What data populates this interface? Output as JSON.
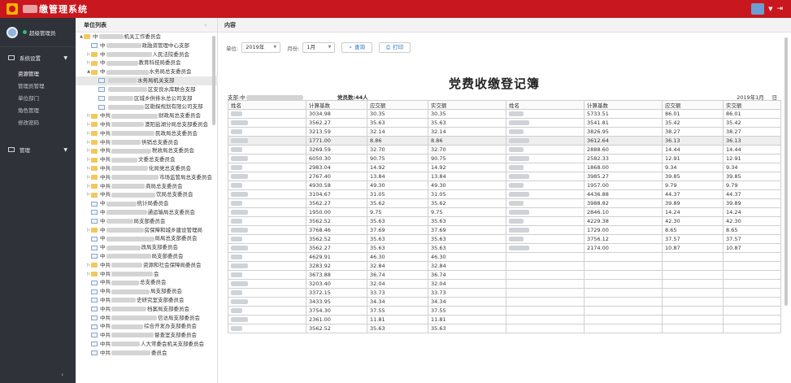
{
  "app": {
    "title": "缴管理系统"
  },
  "nav": {
    "user": "超级管理员",
    "groups": [
      {
        "label": "系统设置",
        "items": [
          "资源管理",
          "管理员管理",
          "单位部门",
          "角色管理",
          "修改密码"
        ]
      },
      {
        "label": "管理",
        "items": []
      }
    ]
  },
  "tree": {
    "title": "单位列表",
    "collapse_icon": "«",
    "rows": [
      {
        "lvl": 0,
        "exp": "▲",
        "icon": "folder",
        "pre": "中",
        "suf": "机关工作委员会"
      },
      {
        "lvl": 1,
        "exp": "",
        "icon": "doc",
        "pre": "中",
        "suf": "政融资管理中心支部"
      },
      {
        "lvl": 1,
        "exp": "▷",
        "icon": "folder",
        "pre": "中",
        "suf": "人民法院委员会"
      },
      {
        "lvl": 1,
        "exp": "▷",
        "icon": "folder",
        "pre": "中",
        "suf": "教育科技局委员会"
      },
      {
        "lvl": 1,
        "exp": "▲",
        "icon": "folder",
        "pre": "中",
        "suf": "水务局总支委员会"
      },
      {
        "lvl": 2,
        "exp": "",
        "icon": "doc",
        "pre": "",
        "suf": "水务局机关支部",
        "sel": true
      },
      {
        "lvl": 2,
        "exp": "",
        "icon": "doc",
        "pre": "",
        "suf": "区安良水库联合支部"
      },
      {
        "lvl": 2,
        "exp": "",
        "icon": "doc",
        "pre": "",
        "suf": "区城乡供排水总公司支部"
      },
      {
        "lvl": 2,
        "exp": "",
        "icon": "doc",
        "pre": "",
        "suf": "区勘探规划有限公司支部"
      },
      {
        "lvl": 1,
        "exp": "▷",
        "icon": "folder",
        "pre": "中共",
        "suf": "财政局总支委员会"
      },
      {
        "lvl": 1,
        "exp": "▷",
        "icon": "folder",
        "pre": "中共",
        "suf": "澳阳盐湖分局总支部委员会"
      },
      {
        "lvl": 1,
        "exp": "▷",
        "icon": "folder",
        "pre": "中共",
        "suf": "民政局总支委员会"
      },
      {
        "lvl": 1,
        "exp": "▷",
        "icon": "folder",
        "pre": "中共",
        "suf": "供销总支委员会"
      },
      {
        "lvl": 1,
        "exp": "▷",
        "icon": "folder",
        "pre": "中共",
        "suf": "税收局总支委员会"
      },
      {
        "lvl": 1,
        "exp": "▷",
        "icon": "folder",
        "pre": "中共",
        "suf": "文委总支委员会"
      },
      {
        "lvl": 1,
        "exp": "▷",
        "icon": "folder",
        "pre": "中共",
        "suf": "化局党总支委员会"
      },
      {
        "lvl": 1,
        "exp": "▷",
        "icon": "folder",
        "pre": "中共",
        "suf": "市场监管局总支委员会"
      },
      {
        "lvl": 1,
        "exp": "▷",
        "icon": "folder",
        "pre": "中共",
        "suf": "商局总支委员会"
      },
      {
        "lvl": 1,
        "exp": "▷",
        "icon": "folder",
        "pre": "中共",
        "suf": "饮局总支委员会"
      },
      {
        "lvl": 1,
        "exp": "",
        "icon": "doc",
        "pre": "中",
        "suf": "统计局委员会"
      },
      {
        "lvl": 1,
        "exp": "",
        "icon": "doc",
        "pre": "中",
        "suf": "通运输局总支委员会"
      },
      {
        "lvl": 1,
        "exp": "",
        "icon": "doc",
        "pre": "中",
        "suf": "局支部委员会"
      },
      {
        "lvl": 1,
        "exp": "▷",
        "icon": "folder",
        "pre": "中",
        "suf": "房保障和城乡建设管理局"
      },
      {
        "lvl": 1,
        "exp": "",
        "icon": "doc",
        "pre": "中",
        "suf": "局局总支部委员会"
      },
      {
        "lvl": 1,
        "exp": "",
        "icon": "doc",
        "pre": "中",
        "suf": "改局支部委员会"
      },
      {
        "lvl": 1,
        "exp": "",
        "icon": "doc",
        "pre": "中",
        "suf": "局支部委员会"
      },
      {
        "lvl": 1,
        "exp": "▷",
        "icon": "folder",
        "pre": "中共",
        "suf": "资源和社会保障局委员会"
      },
      {
        "lvl": 1,
        "exp": "▷",
        "icon": "folder",
        "pre": "中共",
        "suf": "会"
      },
      {
        "lvl": 1,
        "exp": "",
        "icon": "doc",
        "pre": "中共",
        "suf": "总支委员会"
      },
      {
        "lvl": 1,
        "exp": "",
        "icon": "doc",
        "pre": "中共",
        "suf": "局支部委员会"
      },
      {
        "lvl": 1,
        "exp": "",
        "icon": "doc",
        "pre": "中共",
        "suf": "史研究室支部委员会"
      },
      {
        "lvl": 1,
        "exp": "",
        "icon": "doc",
        "pre": "中共",
        "suf": "档案局支部委员会"
      },
      {
        "lvl": 1,
        "exp": "",
        "icon": "doc",
        "pre": "中共",
        "suf": "信访局支部委员会"
      },
      {
        "lvl": 1,
        "exp": "",
        "icon": "doc",
        "pre": "中共",
        "suf": "综合开发办支部委员会"
      },
      {
        "lvl": 1,
        "exp": "",
        "icon": "doc",
        "pre": "中共",
        "suf": "督查室支部委员会"
      },
      {
        "lvl": 1,
        "exp": "",
        "icon": "doc",
        "pre": "中共",
        "suf": "人大常委会机关支部委员会"
      },
      {
        "lvl": 1,
        "exp": "",
        "icon": "doc",
        "pre": "中共",
        "suf": "委员会"
      }
    ]
  },
  "content": {
    "title": "内容",
    "filters": {
      "unit_label": "单位:",
      "year_value": "2019年",
      "month_label": "月份:",
      "month_value": "1月",
      "query_label": "查询",
      "print_label": "打印"
    },
    "document": {
      "title": "党费收缴登记簿",
      "party_label": "支部:中",
      "member_count": "党员数:44人",
      "period": "2019年1月___日"
    },
    "table": {
      "headers": [
        "姓名",
        "计算基数",
        "应交额",
        "实交额",
        "姓名",
        "计算基数",
        "应交额",
        "实交额"
      ],
      "rows": [
        [
          "",
          "3034.98",
          "30.35",
          "30.35",
          "",
          "5733.51",
          "86.01",
          "86.01"
        ],
        [
          "",
          "3562.27",
          "35.63",
          "35.63",
          "",
          "3541.81",
          "35.42",
          "35.42"
        ],
        [
          "",
          "3213.59",
          "32.14",
          "32.14",
          "",
          "3826.95",
          "38.27",
          "38.27"
        ],
        [
          "",
          "1771.00",
          "8.86",
          "8.86",
          "",
          "3612.64",
          "36.13",
          "36.13"
        ],
        [
          "",
          "3269.59",
          "32.70",
          "32.70",
          "",
          "2888.60",
          "14.44",
          "14.44"
        ],
        [
          "",
          "6050.30",
          "90.75",
          "90.75",
          "",
          "2582.33",
          "12.91",
          "12.91"
        ],
        [
          "",
          "2983.04",
          "14.92",
          "14.92",
          "",
          "1868.00",
          "9.34",
          "9.34"
        ],
        [
          "",
          "2767.40",
          "13.84",
          "13.84",
          "",
          "3985.27",
          "39.85",
          "39.85"
        ],
        [
          "",
          "4930.58",
          "49.30",
          "49.30",
          "",
          "1957.00",
          "9.79",
          "9.79"
        ],
        [
          "",
          "3104.67",
          "31.05",
          "31.05",
          "",
          "4436.88",
          "44.37",
          "44.37"
        ],
        [
          "",
          "3562.27",
          "35.62",
          "35.62",
          "",
          "3988.82",
          "39.89",
          "39.89"
        ],
        [
          "",
          "1950.00",
          "9.75",
          "9.75",
          "",
          "2846.10",
          "14.24",
          "14.24"
        ],
        [
          "",
          "3562.52",
          "35.63",
          "35.63",
          "",
          "4229.38",
          "42.30",
          "42.30"
        ],
        [
          "",
          "3768.46",
          "37.69",
          "37.69",
          "",
          "1729.00",
          "8.65",
          "8.65"
        ],
        [
          "",
          "3562.52",
          "35.63",
          "35.63",
          "",
          "3756.12",
          "37.57",
          "37.57"
        ],
        [
          "",
          "3562.27",
          "35.63",
          "35.63",
          "",
          "2174.00",
          "10.87",
          "10.87"
        ],
        [
          "",
          "4629.91",
          "46.30",
          "46.30",
          "",
          "",
          "",
          ""
        ],
        [
          "",
          "3283.92",
          "32.84",
          "32.84",
          "",
          "",
          "",
          ""
        ],
        [
          "",
          "3673.88",
          "36.74",
          "36.74",
          "",
          "",
          "",
          ""
        ],
        [
          "",
          "3203.40",
          "32.04",
          "32.04",
          "",
          "",
          "",
          ""
        ],
        [
          "",
          "3372.15",
          "33.73",
          "33.73",
          "",
          "",
          "",
          ""
        ],
        [
          "",
          "3433.95",
          "34.34",
          "34.34",
          "",
          "",
          "",
          ""
        ],
        [
          "",
          "3754.30",
          "37.55",
          "37.55",
          "",
          "",
          "",
          ""
        ],
        [
          "",
          "2361.00",
          "11.81",
          "11.81",
          "",
          "",
          "",
          ""
        ],
        [
          "",
          "3562.52",
          "35.63",
          "35.63",
          "",
          "",
          "",
          ""
        ]
      ]
    }
  }
}
